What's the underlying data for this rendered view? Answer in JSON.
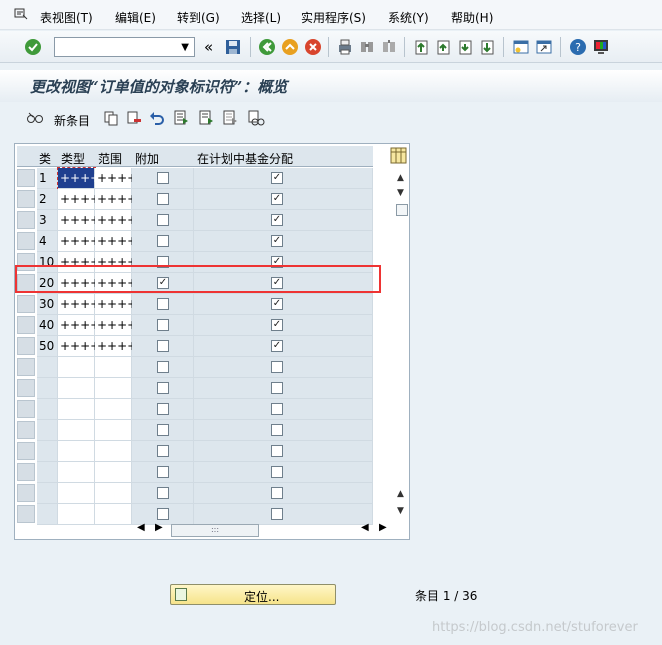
{
  "menu": {
    "items": [
      "表视图(T)",
      "编辑(E)",
      "转到(G)",
      "选择(L)",
      "实用程序(S)",
      "系统(Y)",
      "帮助(H)"
    ]
  },
  "toolbar": {
    "command_value": "",
    "nav_back": "«"
  },
  "title": "更改视图“订单值的对象标识符”：概览",
  "app_toolbar": {
    "new_entries": "新条目"
  },
  "table": {
    "columns": [
      "类",
      "类型",
      "范围",
      "附加",
      "在计划中基金分配"
    ],
    "rows": [
      {
        "cls": "1",
        "type": "++++",
        "range": "++++",
        "add": false,
        "fund": true
      },
      {
        "cls": "2",
        "type": "++++",
        "range": "++++",
        "add": false,
        "fund": true
      },
      {
        "cls": "3",
        "type": "++++",
        "range": "++++",
        "add": false,
        "fund": true
      },
      {
        "cls": "4",
        "type": "++++",
        "range": "++++",
        "add": false,
        "fund": true
      },
      {
        "cls": "10",
        "type": "++++",
        "range": "++++",
        "add": false,
        "fund": true
      },
      {
        "cls": "20",
        "type": "++++",
        "range": "++++",
        "add": true,
        "fund": true
      },
      {
        "cls": "30",
        "type": "++++",
        "range": "++++",
        "add": false,
        "fund": true
      },
      {
        "cls": "40",
        "type": "++++",
        "range": "++++",
        "add": false,
        "fund": true
      },
      {
        "cls": "50",
        "type": "++++",
        "range": "++++",
        "add": false,
        "fund": true
      },
      {
        "cls": "",
        "type": "",
        "range": "",
        "add": false,
        "fund": false
      },
      {
        "cls": "",
        "type": "",
        "range": "",
        "add": false,
        "fund": false
      },
      {
        "cls": "",
        "type": "",
        "range": "",
        "add": false,
        "fund": false
      },
      {
        "cls": "",
        "type": "",
        "range": "",
        "add": false,
        "fund": false
      },
      {
        "cls": "",
        "type": "",
        "range": "",
        "add": false,
        "fund": false
      },
      {
        "cls": "",
        "type": "",
        "range": "",
        "add": false,
        "fund": false
      },
      {
        "cls": "",
        "type": "",
        "range": "",
        "add": false,
        "fund": false
      },
      {
        "cls": "",
        "type": "",
        "range": "",
        "add": false,
        "fund": false
      }
    ],
    "hscroll_grip": ":::"
  },
  "locate_button": "定位...",
  "status": "条目 1 / 36",
  "watermark": "https://blog.csdn.net/stuforever",
  "colors": {
    "highlight": "#e33333",
    "button": "#f6e38a",
    "background": "#eaf1f6"
  }
}
